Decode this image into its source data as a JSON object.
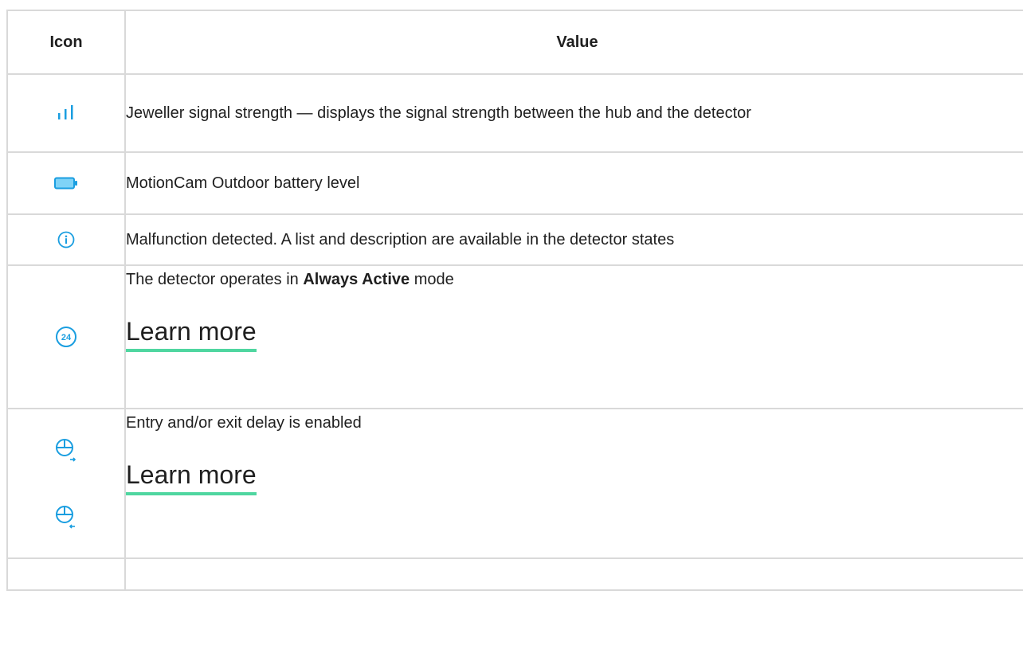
{
  "headers": {
    "icon": "Icon",
    "value": "Value"
  },
  "rows": [
    {
      "icon": "signal-strength-icon",
      "text": "Jeweller signal strength — displays the signal strength between the hub and the detector"
    },
    {
      "icon": "battery-icon",
      "text": "MotionCam Outdoor battery level"
    },
    {
      "icon": "info-icon",
      "text": "Malfunction detected. A list and description are available in the detector states"
    },
    {
      "icon": "always-active-24-icon",
      "badge": "24",
      "text_before": "The detector operates in ",
      "text_bold": "Always Active",
      "text_after": " mode",
      "link": "Learn more"
    },
    {
      "icons": [
        "entry-delay-icon",
        "exit-delay-icon"
      ],
      "text": "Entry and/or exit delay is enabled",
      "link": "Learn more"
    }
  ],
  "colors": {
    "accent": "#1a9ee0",
    "battery_fill": "#7fd3f7",
    "link_underline": "#4fd6a0",
    "border": "#d9d9d9"
  }
}
